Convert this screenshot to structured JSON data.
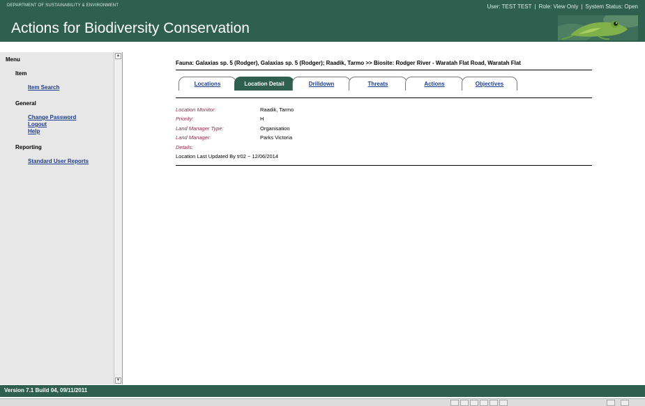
{
  "header": {
    "department": "DEPARTMENT OF SUSTAINABILITY & ENVIRONMENT",
    "user": "User: TEST TEST",
    "role": "Role: View Only",
    "system_status": "System Status: Open",
    "separator": "|",
    "app_title": "Actions for Biodiversity Conservation",
    "banner_image": "frog-icon"
  },
  "sidebar": {
    "menu_label": "Menu",
    "groups": [
      {
        "label": "Item",
        "links": [
          "Item Search"
        ]
      },
      {
        "label": "General",
        "links": [
          "Change Password",
          "Logout",
          "Help"
        ]
      },
      {
        "label": "Reporting",
        "links": [
          "Standard User Reports"
        ]
      }
    ]
  },
  "main": {
    "breadcrumb": "Fauna: Galaxias sp. 5 (Rodger), Galaxias sp. 5 (Rodger); Raadik, Tarmo >> Biosite: Rodger River - Waratah Flat Road, Waratah Flat",
    "tabs": [
      {
        "label": "Locations",
        "active": false
      },
      {
        "label": "Location Detail",
        "active": true
      },
      {
        "label": "Drilldown",
        "active": false
      },
      {
        "label": "Threats",
        "active": false
      },
      {
        "label": "Actions",
        "active": false
      },
      {
        "label": "Objectives",
        "active": false
      }
    ],
    "details": [
      {
        "label": "Location Monitor:",
        "value": "Raadik, Tarmo"
      },
      {
        "label": "Priority:",
        "value": "H"
      },
      {
        "label": "Land Manager Type:",
        "value": "Organisation"
      },
      {
        "label": "Land Manager:",
        "value": "Parks Victoria"
      },
      {
        "label": "Details:",
        "value": ""
      }
    ],
    "last_updated": "Location Last Updated By tr02 ~ 12/06/2014"
  },
  "footer": {
    "version": "Version 7.1 Build 04, 09/11/2011"
  },
  "colors": {
    "brand_green": "#2f5f4f",
    "link_blue": "#1e3c8c",
    "label_maroon": "#8b2a4a"
  }
}
